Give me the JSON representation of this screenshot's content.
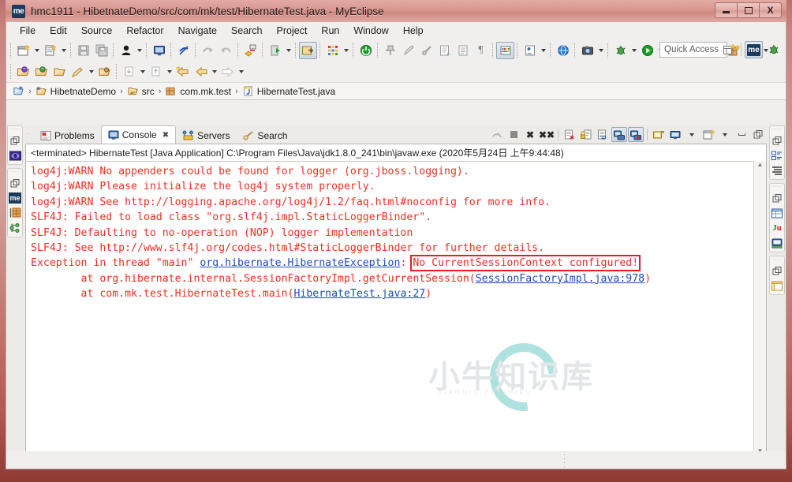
{
  "window": {
    "app_icon": "me",
    "title": "hmc1911 - HibetnateDemo/src/com/mk/test/HibernateTest.java - MyEclipse",
    "controls": {
      "minimize": "minimize-icon",
      "maximize": "maximize-icon",
      "close": "X"
    }
  },
  "menubar": {
    "items": [
      {
        "label": "File"
      },
      {
        "label": "Edit"
      },
      {
        "label": "Source"
      },
      {
        "label": "Refactor"
      },
      {
        "label": "Navigate"
      },
      {
        "label": "Search"
      },
      {
        "label": "Project"
      },
      {
        "label": "Run"
      },
      {
        "label": "Window"
      },
      {
        "label": "Help"
      }
    ]
  },
  "toolbar": {
    "quick_access_placeholder": "Quick Access",
    "row1_icons": [
      "new-wizard-icon",
      "new-dropdown-arrow",
      "new-file-icon",
      "new-file-dropdown-arrow",
      "save-icon",
      "save-all-icon",
      "user-icon",
      "user-dropdown-arrow",
      "console-icon",
      "no-link-icon",
      "undo-icon",
      "redo-icon",
      "deploy-icon",
      "run-server-icon",
      "run-server-dropdown-arrow",
      "open-perspective-icon",
      "matrix-icon",
      "matrix-dropdown-arrow",
      "power-icon",
      "pin-icon",
      "pen-icon",
      "marker-icon",
      "script-icon",
      "list-icon",
      "pilcrow-icon",
      "grid-colors-icon",
      "export-icon",
      "export-dropdown-arrow",
      "web-icon",
      "snapshot-icon",
      "snapshot-dropdown-arrow",
      "debug-icon",
      "debug-dropdown-arrow",
      "run-icon",
      "run-dropdown-arrow",
      "run-config-icon",
      "run-config-dropdown-arrow",
      "coverage-icon",
      "coverage-dropdown-arrow",
      "new-table-icon",
      "refresh-icon",
      "refresh-dropdown-arrow"
    ],
    "row2_icons": [
      "open-type-icon",
      "open-resource-icon",
      "open-folder-icon",
      "pencil-icon",
      "pencil-dropdown-arrow",
      "package-icon",
      "download-icon",
      "download-dropdown-arrow",
      "upload-icon",
      "upload-dropdown-arrow",
      "back-star-icon",
      "back-icon",
      "back-dropdown-arrow",
      "forward-icon",
      "forward-dropdown-arrow"
    ],
    "right_icons": [
      "new-perspective-icon",
      "myeclipse-perspective-icon",
      "debug-perspective-icon"
    ]
  },
  "breadcrumb": {
    "items": [
      {
        "label": "",
        "icon": "workspace-icon"
      },
      {
        "label": "HibetnateDemo",
        "icon": "project-icon"
      },
      {
        "label": "src",
        "icon": "source-folder-icon"
      },
      {
        "label": "com.mk.test",
        "icon": "package-icon"
      },
      {
        "label": "HibernateTest.java",
        "icon": "java-file-icon"
      }
    ],
    "separator": "›"
  },
  "left_rail": {
    "groups": [
      {
        "icons": [
          "restore-icon",
          "package-explorer-icon"
        ]
      },
      {
        "icons": [
          "restore-icon",
          "myeclipse-explorer-icon",
          "db-browser-icon",
          "hierarchy-icon"
        ]
      }
    ]
  },
  "right_rail": {
    "groups": [
      {
        "icons": [
          "restore-icon",
          "outline-icon",
          "task-list-icon"
        ]
      },
      {
        "icons": [
          "restore-icon",
          "properties-icon",
          "junit-icon",
          "snippets-icon"
        ]
      },
      {
        "icons": [
          "restore-icon",
          "web-browser-icon"
        ]
      }
    ]
  },
  "panel": {
    "tabs": [
      {
        "label": "Problems",
        "icon": "problems-icon",
        "active": false,
        "closable": false
      },
      {
        "label": "Console",
        "icon": "console-icon",
        "active": true,
        "closable": true
      },
      {
        "label": "Servers",
        "icon": "servers-icon",
        "active": false,
        "closable": false
      },
      {
        "label": "Search",
        "icon": "search-icon",
        "active": false,
        "closable": false
      }
    ],
    "tab_close_glyph": "✖",
    "toolbar_icons": [
      "link-broken-icon",
      "terminate-icon",
      "remove-launch-icon",
      "remove-all-launches-icon",
      "clear-console-icon",
      "scroll-lock-icon",
      "word-wrap-icon",
      "show-console-on-output-icon",
      "show-console-on-error-icon",
      "pin-console-icon",
      "display-selected-console-icon",
      "display-selected-dropdown-arrow",
      "open-console-icon",
      "open-console-dropdown-arrow",
      "minimize-icon",
      "maximize-icon"
    ],
    "terminated_line": "<terminated> HibernateTest [Java Application] C:\\Program Files\\Java\\jdk1.8.0_241\\bin\\javaw.exe (2020年5月24日 上午9:44:48)"
  },
  "console": {
    "lines": [
      {
        "segments": [
          {
            "text": "log4j:WARN No appenders could be found for logger (org.jboss.logging).",
            "style": "err"
          }
        ]
      },
      {
        "segments": [
          {
            "text": "log4j:WARN Please initialize the log4j system properly.",
            "style": "err"
          }
        ]
      },
      {
        "segments": [
          {
            "text": "log4j:WARN See http://logging.apache.org/log4j/1.2/faq.html#noconfig for more info.",
            "style": "err"
          }
        ]
      },
      {
        "segments": [
          {
            "text": "SLF4J: Failed to load class \"org.slf4j.impl.StaticLoggerBinder\".",
            "style": "err"
          }
        ]
      },
      {
        "segments": [
          {
            "text": "SLF4J: Defaulting to no-operation (NOP) logger implementation",
            "style": "err"
          }
        ]
      },
      {
        "segments": [
          {
            "text": "SLF4J: See http://www.slf4j.org/codes.html#StaticLoggerBinder for further details.",
            "style": "err"
          }
        ]
      },
      {
        "segments": [
          {
            "text": "Exception in thread \"main\" ",
            "style": "err"
          },
          {
            "text": "org.hibernate.HibernateException",
            "style": "link"
          },
          {
            "text": ": ",
            "style": "err"
          },
          {
            "text": "No CurrentSessionContext configured!",
            "style": "err-boxed"
          }
        ]
      },
      {
        "segments": [
          {
            "text": "\tat org.hibernate.internal.SessionFactoryImpl.getCurrentSession(",
            "style": "err"
          },
          {
            "text": "SessionFactoryImpl.java:978",
            "style": "link"
          },
          {
            "text": ")",
            "style": "err"
          }
        ]
      },
      {
        "segments": [
          {
            "text": "\tat com.mk.test.HibernateTest.main(",
            "style": "err"
          },
          {
            "text": "HibernateTest.java:27",
            "style": "link"
          },
          {
            "text": ")",
            "style": "err"
          }
        ]
      }
    ],
    "error_color": "#ff2a1f",
    "link_color": "#1f49c9",
    "highlight_box_color": "#ee1b24",
    "background": "#ffffff"
  },
  "watermark": {
    "text": "小牛知识库",
    "subtext": "XIAONIU ZHISHIKU"
  },
  "scrollbars": {
    "vertical": {
      "up": "▲",
      "down": "▼"
    },
    "horizontal": {
      "left": "◀",
      "right": "▶"
    }
  }
}
